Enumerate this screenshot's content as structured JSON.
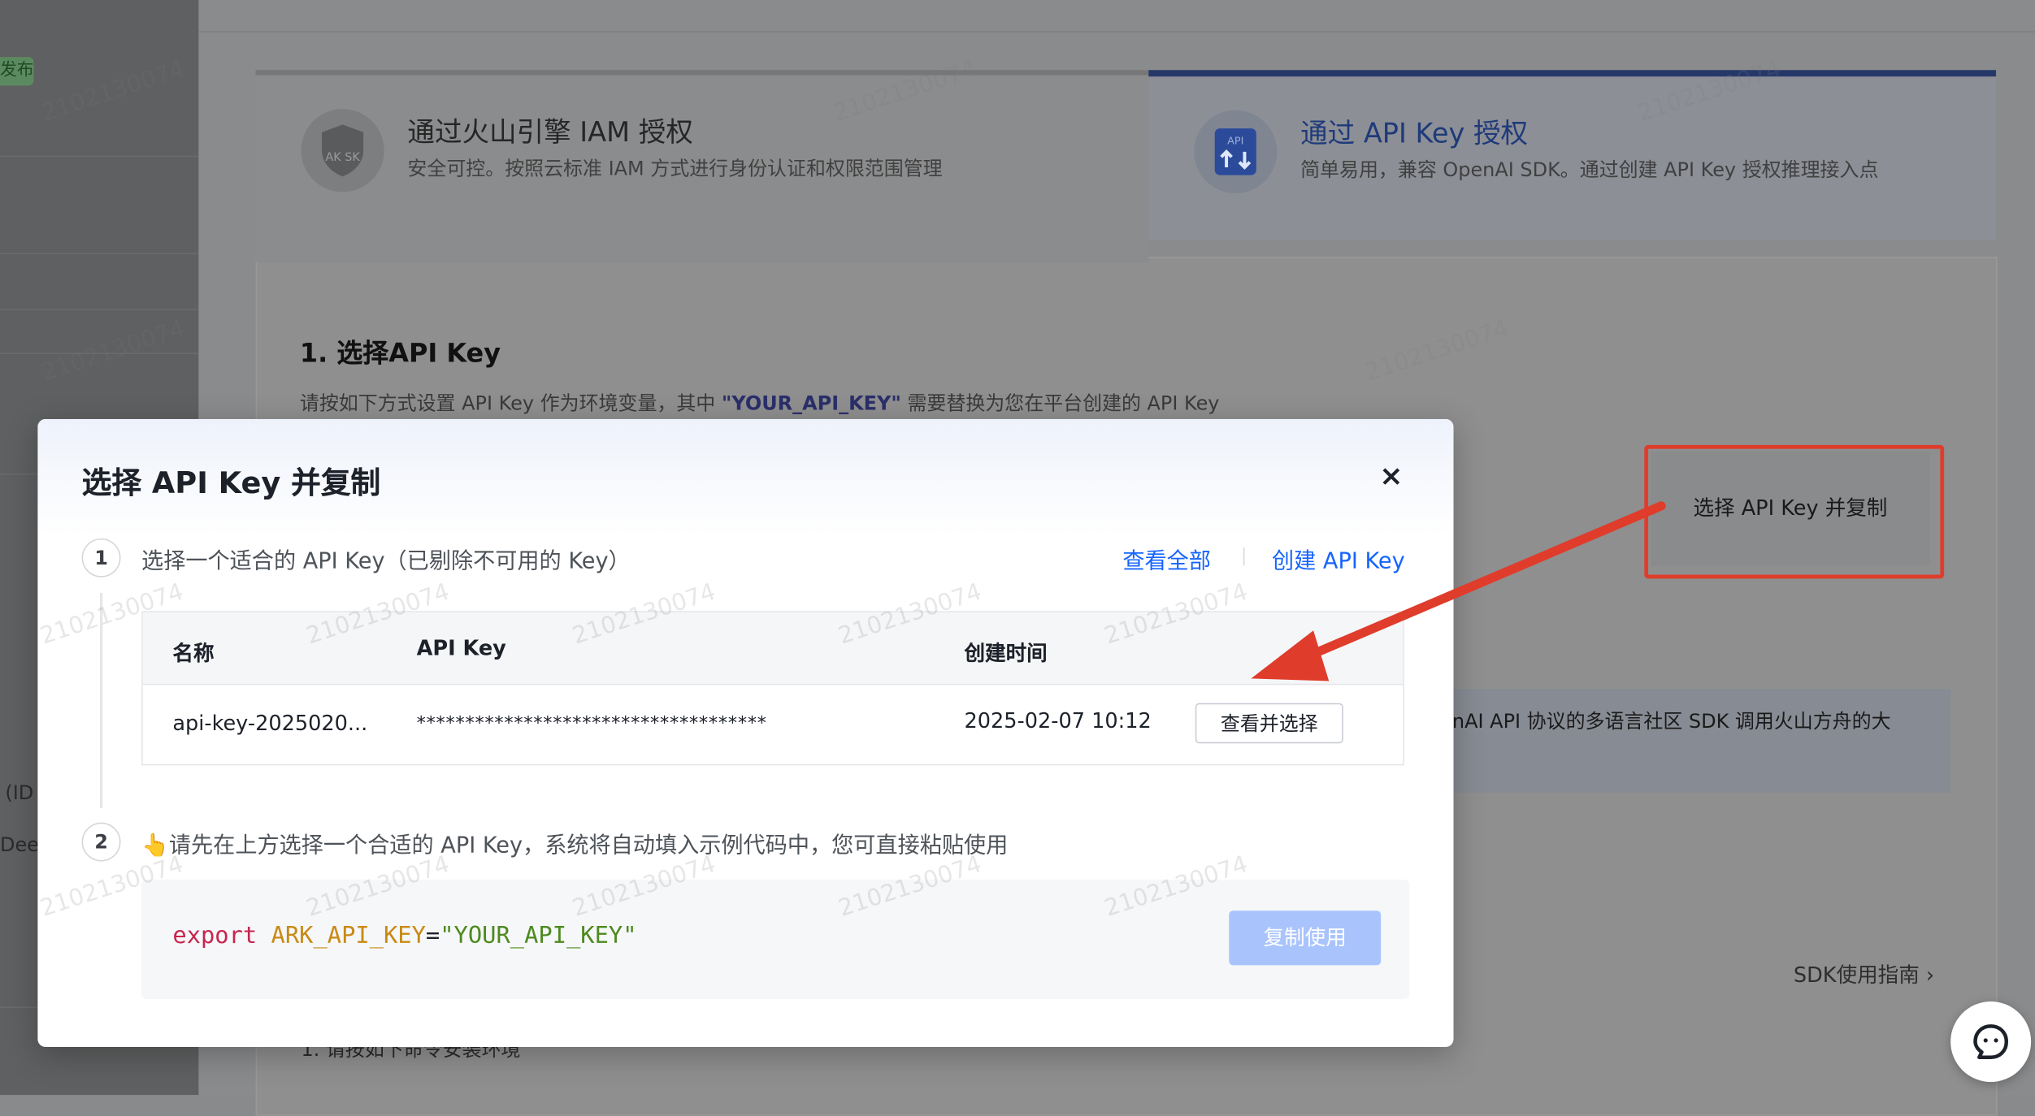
{
  "background": {
    "sidebar": {
      "badge": "发布",
      "text_id": "(ID",
      "text_dee": "Dee"
    },
    "tabs": {
      "iam": {
        "title": "通过火山引擎 IAM 授权",
        "subtitle": "安全可控。按照云标准 IAM 方式进行身份认证和权限范围管理",
        "icon_label": "AK SK"
      },
      "apikey": {
        "title": "通过 API Key 授权",
        "subtitle": "简单易用，兼容 OpenAI SDK。通过创建 API Key 授权推理接入点",
        "icon_label": "API"
      }
    },
    "section": {
      "title": "1. 选择API Key",
      "subtitle_prefix": "请按如下方式设置 API Key 作为环境变量，其中",
      "subtitle_highlight": "\"YOUR_API_KEY\"",
      "subtitle_suffix": "需要替换为您在平台创建的 API Key"
    },
    "select_copy_button": "选择 API Key 并复制",
    "info_text": "nAI API 协议的多语言社区 SDK 调用火山方舟的大",
    "sdk_guide_link": "SDK使用指南 ›",
    "bottom_text": "1. 请按如下命令安装环境",
    "watermark": "2102130074"
  },
  "modal": {
    "title": "选择 API Key 并复制",
    "close": "×",
    "step1": {
      "num": "1",
      "text": "选择一个适合的 API Key（已剔除不可用的 Key）",
      "view_all": "查看全部",
      "create": "创建 API Key"
    },
    "table": {
      "headers": [
        "名称",
        "API Key",
        "创建时间"
      ],
      "rows": [
        {
          "name": "api-key-2025020...",
          "key": "************************************",
          "created": "2025-02-07 10:12",
          "action": "查看并选择"
        }
      ]
    },
    "step2": {
      "num": "2",
      "emoji": "👆",
      "text": "请先在上方选择一个合适的 API Key，系统将自动填入示例代码中，您可直接粘贴使用"
    },
    "code": {
      "keyword": "export",
      "variable": "ARK_API_KEY",
      "operator": "=",
      "value": "\"YOUR_API_KEY\""
    },
    "copy_button": "复制使用"
  },
  "colors": {
    "primary_link": "#1664ff",
    "copy_button_disabled": "#a9c4fd",
    "annotation_red": "#e03c2b"
  }
}
